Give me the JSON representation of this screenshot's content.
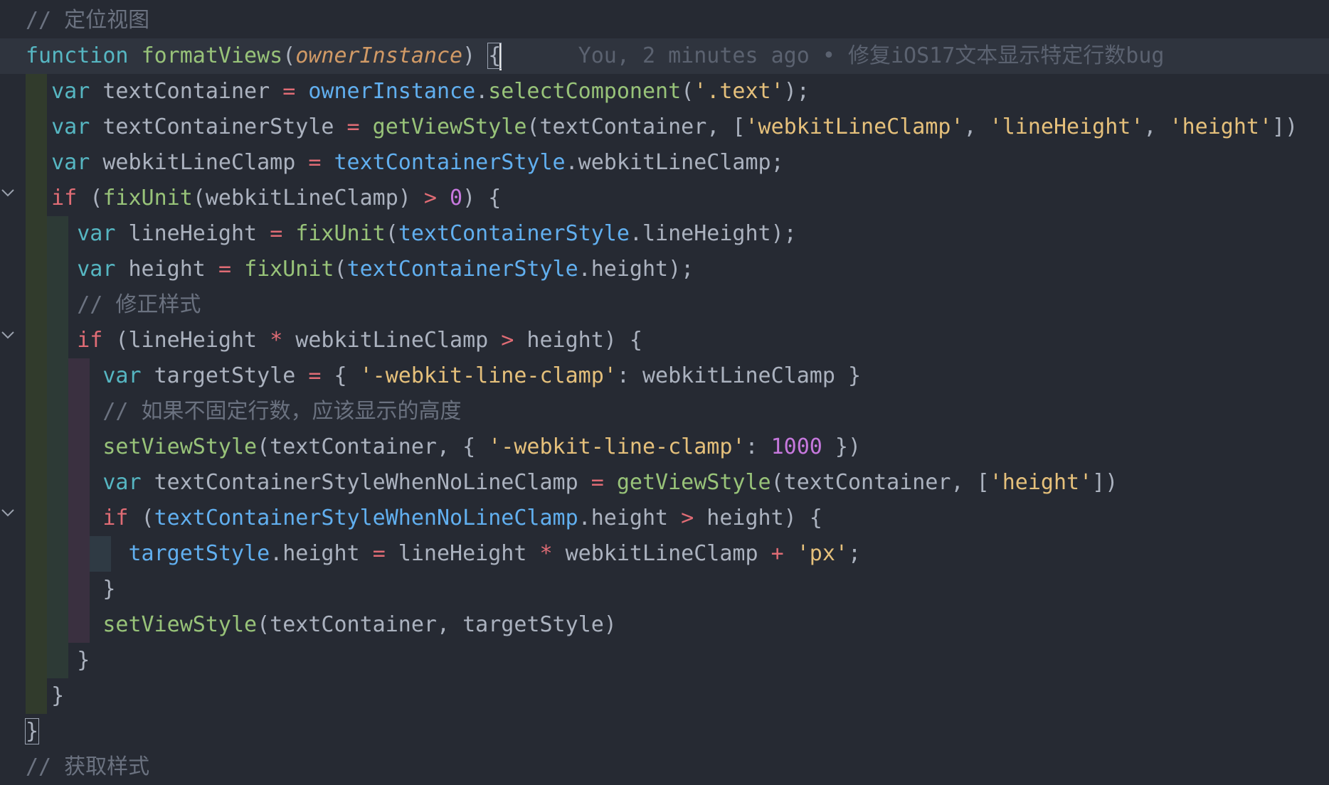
{
  "editor": {
    "blame": "You, 2 minutes ago • 修复iOS17文本显示特定行数bug",
    "lines": [
      {
        "segments": [
          {
            "t": "// 定位视图",
            "c": "cmt"
          }
        ]
      },
      {
        "segments": [
          {
            "t": "function",
            "c": "kw-fn"
          },
          {
            "t": " "
          },
          {
            "t": "formatViews",
            "c": "fn"
          },
          {
            "t": "("
          },
          {
            "t": "ownerInstance",
            "c": "param"
          },
          {
            "t": ") "
          },
          {
            "t": "{",
            "c": "match-brace"
          }
        ]
      },
      {
        "segments": [
          {
            "t": "  "
          },
          {
            "t": "var",
            "c": "kw-var"
          },
          {
            "t": " textContainer "
          },
          {
            "t": "=",
            "c": "op"
          },
          {
            "t": " "
          },
          {
            "t": "ownerInstance",
            "c": "prop"
          },
          {
            "t": "."
          },
          {
            "t": "selectComponent",
            "c": "fn"
          },
          {
            "t": "("
          },
          {
            "t": "'.text'",
            "c": "str"
          },
          {
            "t": ");"
          }
        ]
      },
      {
        "segments": [
          {
            "t": "  "
          },
          {
            "t": "var",
            "c": "kw-var"
          },
          {
            "t": " textContainerStyle "
          },
          {
            "t": "=",
            "c": "op"
          },
          {
            "t": " "
          },
          {
            "t": "getViewStyle",
            "c": "fn"
          },
          {
            "t": "(textContainer, ["
          },
          {
            "t": "'webkitLineClamp'",
            "c": "str"
          },
          {
            "t": ", "
          },
          {
            "t": "'lineHeight'",
            "c": "str"
          },
          {
            "t": ", "
          },
          {
            "t": "'height'",
            "c": "str"
          },
          {
            "t": "])"
          }
        ]
      },
      {
        "segments": [
          {
            "t": "  "
          },
          {
            "t": "var",
            "c": "kw-var"
          },
          {
            "t": " webkitLineClamp "
          },
          {
            "t": "=",
            "c": "op"
          },
          {
            "t": " "
          },
          {
            "t": "textContainerStyle",
            "c": "prop"
          },
          {
            "t": ".webkitLineClamp;"
          }
        ]
      },
      {
        "segments": [
          {
            "t": "  "
          },
          {
            "t": "if",
            "c": "kw-if"
          },
          {
            "t": " ("
          },
          {
            "t": "fixUnit",
            "c": "fn"
          },
          {
            "t": "(webkitLineClamp) "
          },
          {
            "t": ">",
            "c": "op"
          },
          {
            "t": " "
          },
          {
            "t": "0",
            "c": "num"
          },
          {
            "t": ") {"
          }
        ]
      },
      {
        "segments": [
          {
            "t": "    "
          },
          {
            "t": "var",
            "c": "kw-var"
          },
          {
            "t": " lineHeight "
          },
          {
            "t": "=",
            "c": "op"
          },
          {
            "t": " "
          },
          {
            "t": "fixUnit",
            "c": "fn"
          },
          {
            "t": "("
          },
          {
            "t": "textContainerStyle",
            "c": "prop"
          },
          {
            "t": ".lineHeight);"
          }
        ]
      },
      {
        "segments": [
          {
            "t": "    "
          },
          {
            "t": "var",
            "c": "kw-var"
          },
          {
            "t": " height "
          },
          {
            "t": "=",
            "c": "op"
          },
          {
            "t": " "
          },
          {
            "t": "fixUnit",
            "c": "fn"
          },
          {
            "t": "("
          },
          {
            "t": "textContainerStyle",
            "c": "prop"
          },
          {
            "t": ".height);"
          }
        ]
      },
      {
        "segments": [
          {
            "t": "    "
          },
          {
            "t": "// 修正样式",
            "c": "cmt"
          }
        ]
      },
      {
        "segments": [
          {
            "t": "    "
          },
          {
            "t": "if",
            "c": "kw-if"
          },
          {
            "t": " (lineHeight "
          },
          {
            "t": "*",
            "c": "op"
          },
          {
            "t": " webkitLineClamp "
          },
          {
            "t": ">",
            "c": "op"
          },
          {
            "t": " height) {"
          }
        ]
      },
      {
        "segments": [
          {
            "t": "      "
          },
          {
            "t": "var",
            "c": "kw-var"
          },
          {
            "t": " targetStyle "
          },
          {
            "t": "=",
            "c": "op"
          },
          {
            "t": " { "
          },
          {
            "t": "'-webkit-line-clamp'",
            "c": "str"
          },
          {
            "t": ": webkitLineClamp }"
          }
        ]
      },
      {
        "segments": [
          {
            "t": "      "
          },
          {
            "t": "// 如果不固定行数，应该显示的高度",
            "c": "cmt"
          }
        ]
      },
      {
        "segments": [
          {
            "t": "      "
          },
          {
            "t": "setViewStyle",
            "c": "fn"
          },
          {
            "t": "(textContainer, { "
          },
          {
            "t": "'-webkit-line-clamp'",
            "c": "str"
          },
          {
            "t": ": "
          },
          {
            "t": "1000",
            "c": "num"
          },
          {
            "t": " })"
          }
        ]
      },
      {
        "segments": [
          {
            "t": "      "
          },
          {
            "t": "var",
            "c": "kw-var"
          },
          {
            "t": " textContainerStyleWhenNoLineClamp "
          },
          {
            "t": "=",
            "c": "op"
          },
          {
            "t": " "
          },
          {
            "t": "getViewStyle",
            "c": "fn"
          },
          {
            "t": "(textContainer, ["
          },
          {
            "t": "'height'",
            "c": "str"
          },
          {
            "t": "])"
          }
        ]
      },
      {
        "segments": [
          {
            "t": "      "
          },
          {
            "t": "if",
            "c": "kw-if"
          },
          {
            "t": " ("
          },
          {
            "t": "textContainerStyleWhenNoLineClamp",
            "c": "prop"
          },
          {
            "t": ".height "
          },
          {
            "t": ">",
            "c": "op"
          },
          {
            "t": " height) {"
          }
        ]
      },
      {
        "segments": [
          {
            "t": "        "
          },
          {
            "t": "targetStyle",
            "c": "prop"
          },
          {
            "t": ".height "
          },
          {
            "t": "=",
            "c": "op"
          },
          {
            "t": " lineHeight "
          },
          {
            "t": "*",
            "c": "op"
          },
          {
            "t": " webkitLineClamp "
          },
          {
            "t": "+",
            "c": "op"
          },
          {
            "t": " "
          },
          {
            "t": "'px'",
            "c": "str"
          },
          {
            "t": ";"
          }
        ]
      },
      {
        "segments": [
          {
            "t": "      }"
          }
        ]
      },
      {
        "segments": [
          {
            "t": "      "
          },
          {
            "t": "setViewStyle",
            "c": "fn"
          },
          {
            "t": "(textContainer, targetStyle)"
          }
        ]
      },
      {
        "segments": [
          {
            "t": "    }"
          }
        ]
      },
      {
        "segments": [
          {
            "t": "  }"
          }
        ]
      },
      {
        "segments": [
          {
            "t": "}",
            "c": "match-brace"
          }
        ]
      },
      {
        "segments": [
          {
            "t": "// 获取样式",
            "c": "cmt"
          }
        ]
      }
    ]
  }
}
